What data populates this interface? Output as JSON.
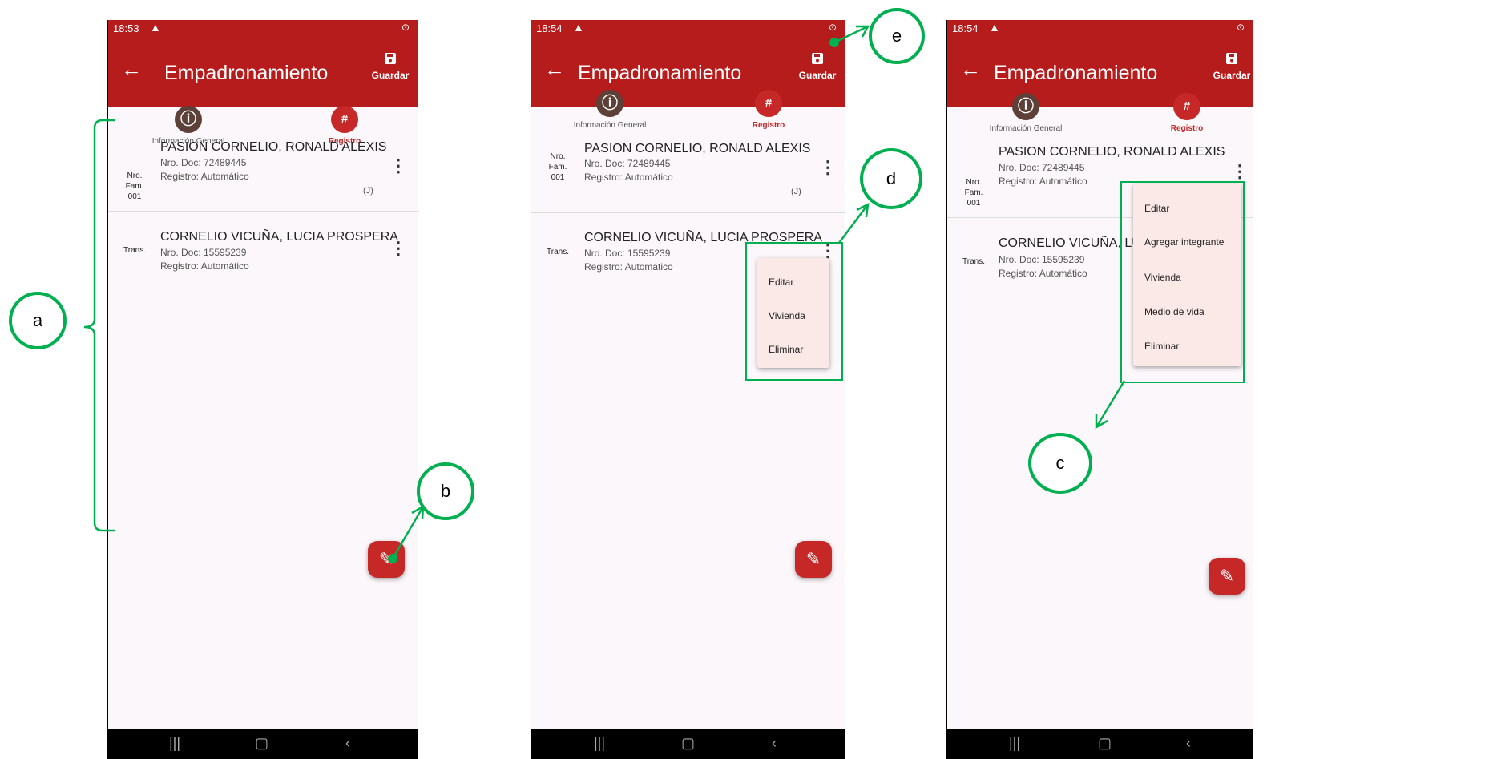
{
  "app": {
    "title": "Empadronamiento",
    "save_label": "Guardar",
    "back_icon": "arrow-left-icon",
    "save_icon": "floppy-disk-icon",
    "accent_color": "#b71c1c"
  },
  "tabs": [
    {
      "label": "Información General",
      "icon": "info-icon"
    },
    {
      "label": "Registro",
      "icon": "registro-icon"
    }
  ],
  "screens": [
    {
      "time": "18:53"
    },
    {
      "time": "18:54"
    },
    {
      "time": "18:54"
    }
  ],
  "records": [
    {
      "prefix_lines": [
        "Nro.",
        "Fam.",
        "001"
      ],
      "name": "PASION CORNELIO, RONALD ALEXIS",
      "doc": "Nro. Doc: 72489445",
      "registro": "Registro: Automático",
      "tag": "(J)"
    },
    {
      "prefix_lines": [
        "Trans."
      ],
      "name": "CORNELIO VICUÑA, LUCIA PROSPERA",
      "doc": "Nro. Doc: 15595239",
      "registro": "Registro: Automático",
      "tag": ""
    }
  ],
  "menu_trans": [
    "Editar",
    "Vivienda",
    "Eliminar"
  ],
  "menu_fam": [
    "Editar",
    "Agregar integrante",
    "Vivienda",
    "Medio de vida",
    "Eliminar"
  ],
  "third_screen_name_visible": "CORNELIO VICUÑA, LUCIA P",
  "annotations": {
    "a": "a",
    "b": "b",
    "c": "c",
    "d": "d",
    "e": "e"
  },
  "annotation_color": "#00b050"
}
